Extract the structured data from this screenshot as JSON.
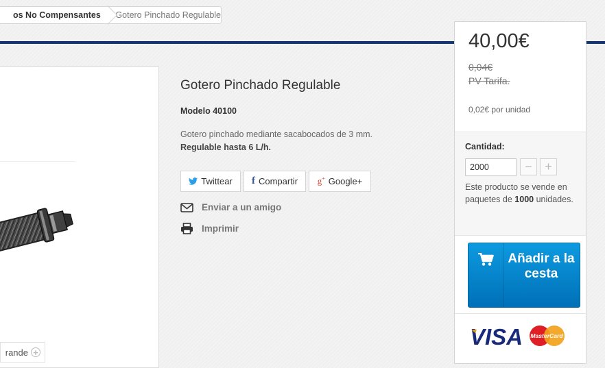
{
  "breadcrumb": {
    "category": "os No Compensantes",
    "current": "Gotero Pinchado Regulable"
  },
  "image_panel": {
    "zoom_label": "rande"
  },
  "product": {
    "title": "Gotero Pinchado Regulable",
    "model_label": "Modelo 40100",
    "description_normal": "Gotero pinchado mediante sacabocados de 3 mm.",
    "description_bold": "Regulable hasta 6 L/h."
  },
  "social": {
    "twitter": "Twittear",
    "facebook": "Compartir",
    "google": "Google+"
  },
  "links": {
    "send_friend": "Enviar a un amigo",
    "print": "Imprimir"
  },
  "buy_box": {
    "price": "40,00€",
    "old_price": "0,04€",
    "old_price_label": "PV Tarifa.",
    "unit_price": "0,02€ por unidad",
    "quantity_label": "Cantidad:",
    "quantity_value": "2000",
    "pack_note_prefix": "Este producto se vende en paquetes de",
    "pack_size": "1000",
    "pack_note_suffix": "unidades.",
    "add_to_cart": "Añadir a la cesta"
  },
  "payment_cards": {
    "visa": "VISA",
    "mastercard": "MasterCard"
  },
  "colors": {
    "accent_blue": "#14366e",
    "cart_button": "#0d86cc"
  }
}
